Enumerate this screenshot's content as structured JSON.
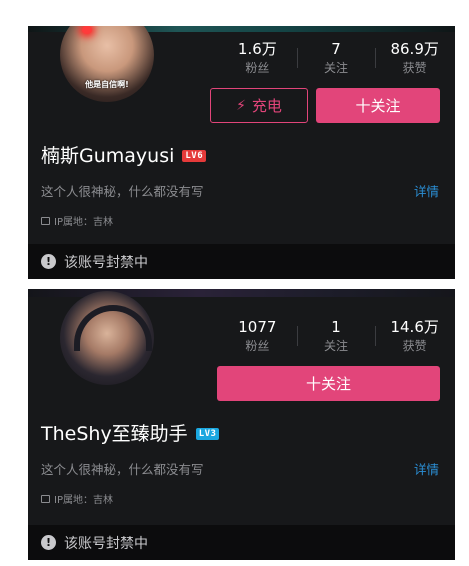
{
  "profiles": [
    {
      "avatar_caption": "他是自信啊!",
      "stats": [
        {
          "value": "1.6万",
          "label": "粉丝"
        },
        {
          "value": "7",
          "label": "关注"
        },
        {
          "value": "86.9万",
          "label": "获赞"
        }
      ],
      "charge_label": "充电",
      "charge_icon": "lightning-bolt-icon",
      "follow_label": "十关注",
      "name": "楠斯Gumayusi",
      "level": "LV6",
      "level_color": "#e53a3a",
      "bio": "这个人很神秘，什么都没有写",
      "detail_label": "详情",
      "ip_location": "IP属地：吉林",
      "ban_text": "该账号封禁中"
    },
    {
      "stats": [
        {
          "value": "1077",
          "label": "粉丝"
        },
        {
          "value": "1",
          "label": "关注"
        },
        {
          "value": "14.6万",
          "label": "获赞"
        }
      ],
      "follow_label": "十关注",
      "name": "TheShy至臻助手",
      "level": "LV3",
      "level_color": "#1aa7e0",
      "bio": "这个人很神秘，什么都没有写",
      "detail_label": "详情",
      "ip_location": "IP属地：吉林",
      "ban_text": "该账号封禁中"
    }
  ],
  "colors": {
    "accent_pink": "#e2457a",
    "link_blue": "#2b8fd6",
    "card_bg": "#17181a"
  }
}
